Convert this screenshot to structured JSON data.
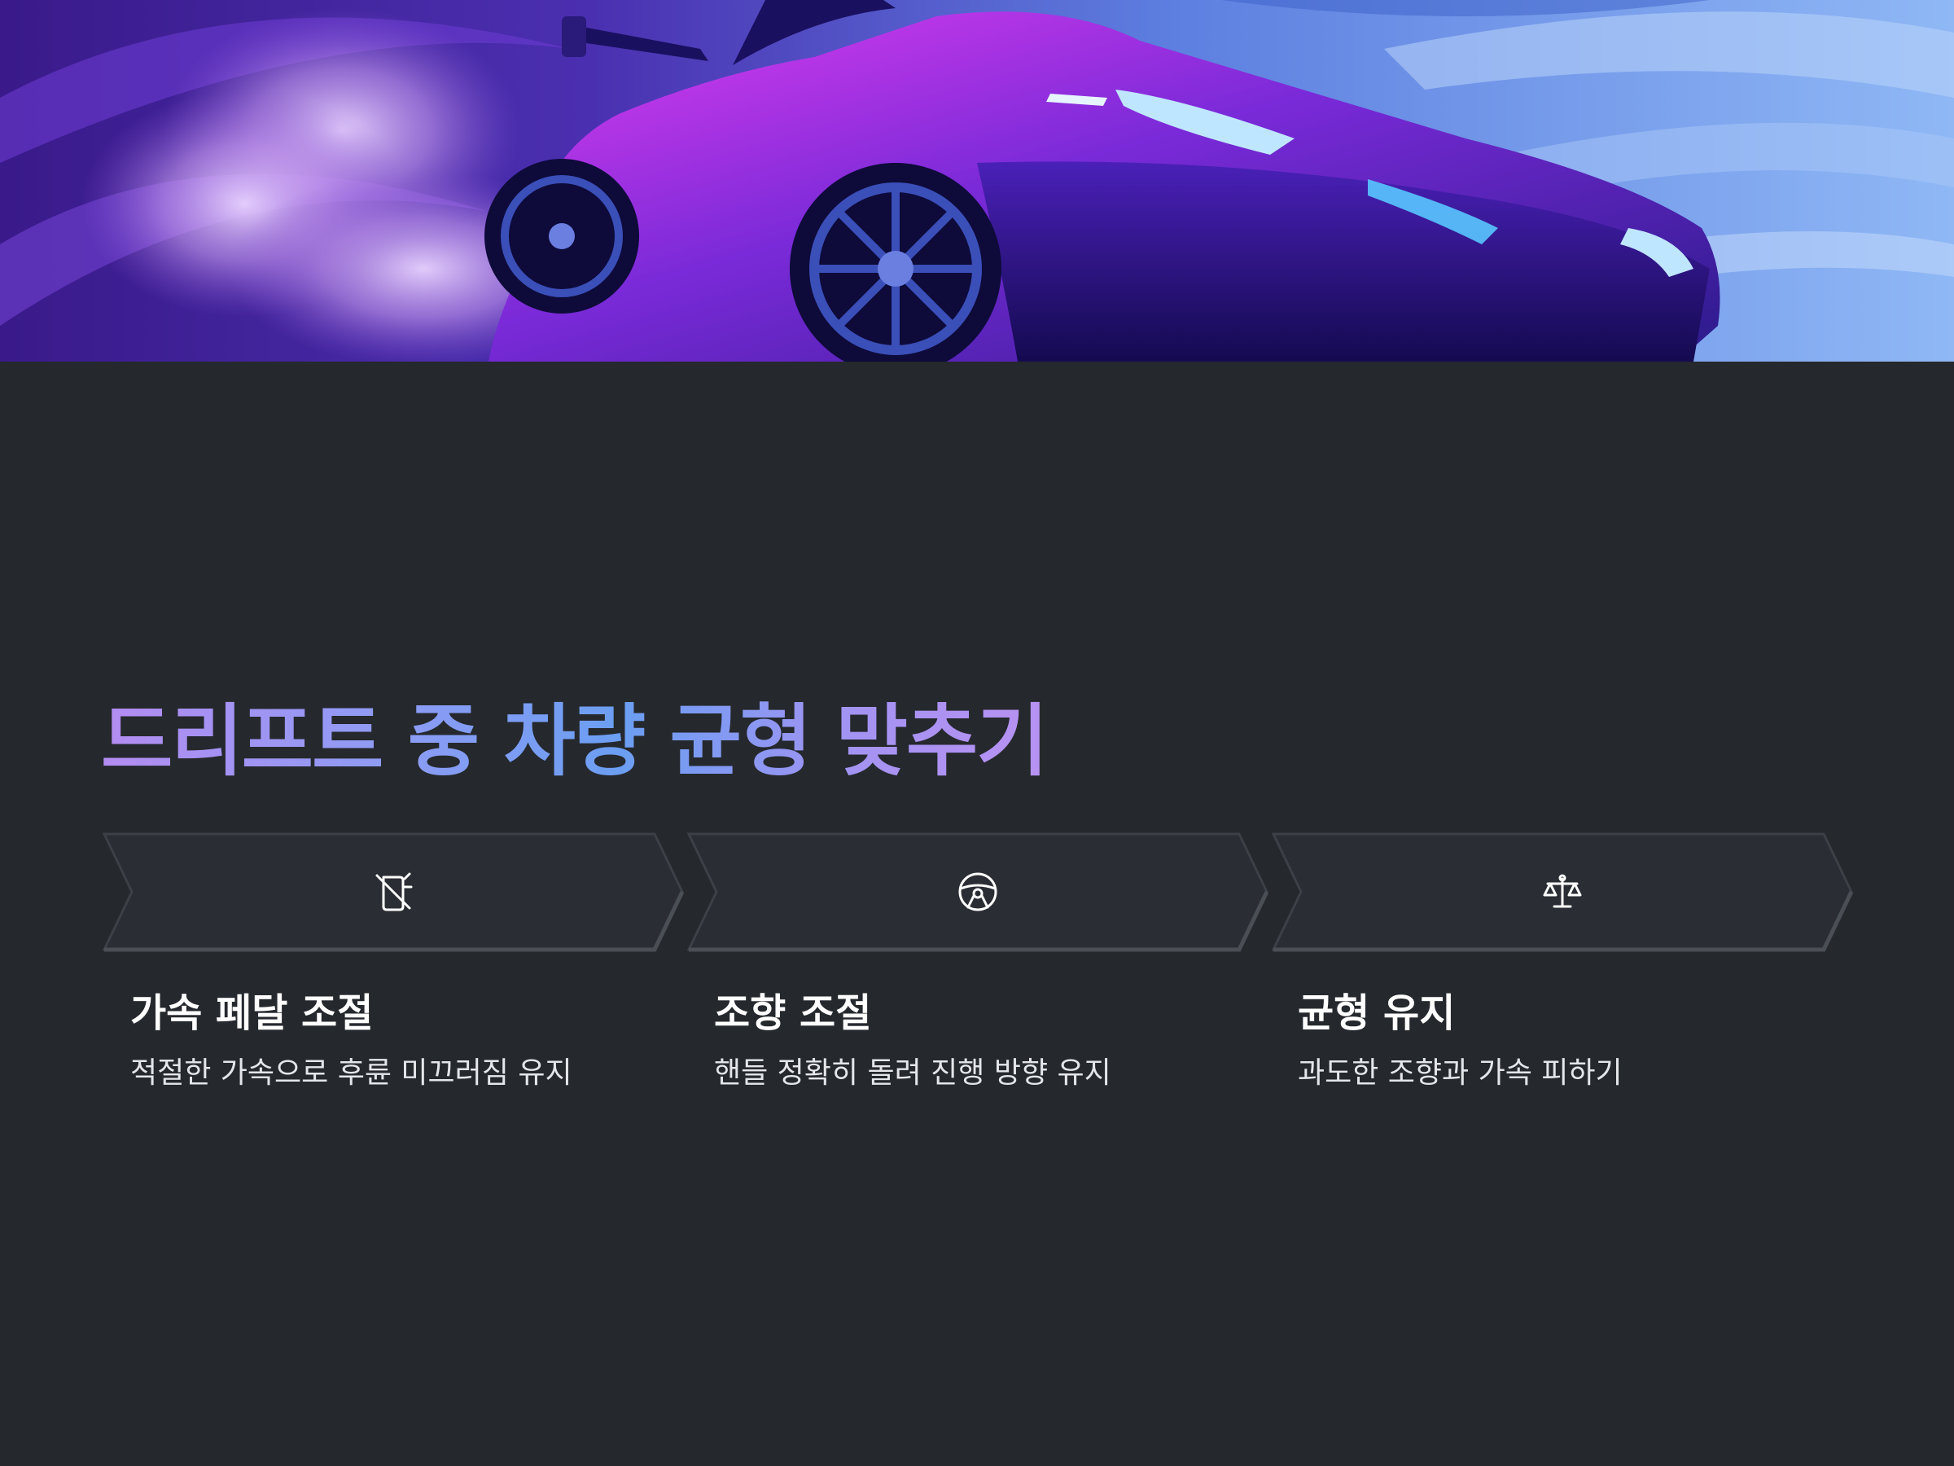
{
  "slide": {
    "title": "드리프트 중 차량 균형 맞추기",
    "hero_image": "purple sports car drifting with smoke"
  },
  "steps": [
    {
      "icon": "no-phone-icon",
      "title": "가속 페달 조절",
      "description": "적절한 가속으로 후륜 미끄러짐 유지"
    },
    {
      "icon": "steering-wheel-icon",
      "title": "조향 조절",
      "description": "핸들 정확히 돌려 진행 방향 유지"
    },
    {
      "icon": "balance-scale-icon",
      "title": "균형 유지",
      "description": "과도한 조향과 가속 피하기"
    }
  ],
  "colors": {
    "background": "#25282d",
    "banner": "#2a2d33",
    "title_gradient_start": "#b48cf2",
    "title_gradient_mid": "#6b9ef2",
    "text": "#ffffff"
  }
}
